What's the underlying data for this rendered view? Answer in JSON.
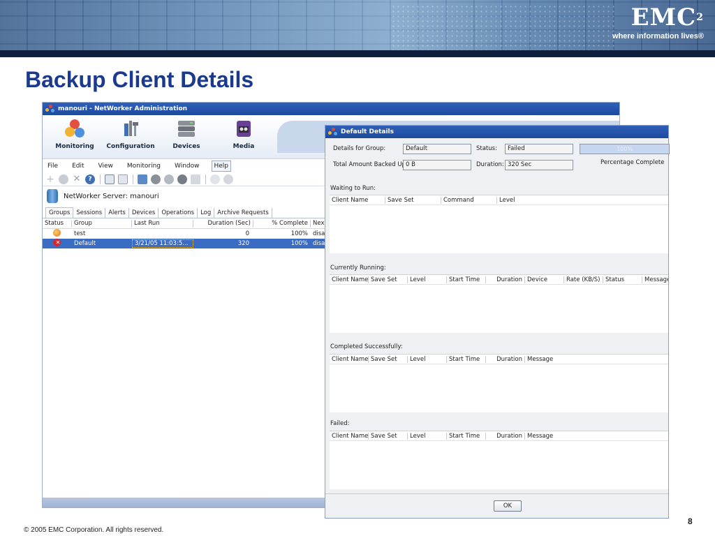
{
  "slide": {
    "title": "Backup Client Details",
    "logo": {
      "brand": "EMC",
      "superscript": "2",
      "tagline": "where information lives®"
    },
    "footer": "© 2005 EMC Corporation. All rights reserved.",
    "page_number": "8"
  },
  "admin": {
    "title": "manouri - NetWorker Administration",
    "nav": [
      "Monitoring",
      "Configuration",
      "Devices",
      "Media"
    ],
    "menu": [
      "File",
      "Edit",
      "View",
      "Monitoring",
      "Window",
      "Help"
    ],
    "server_label": "NetWorker Server: manouri",
    "tabs": [
      "Groups",
      "Sessions",
      "Alerts",
      "Devices",
      "Operations",
      "Log",
      "Archive Requests"
    ],
    "columns": [
      "Status",
      "Group",
      "Last Run",
      "Duration (Sec)",
      "% Complete",
      "Nex"
    ],
    "rows": [
      {
        "group": "test",
        "last_run": "",
        "duration": "0",
        "complete": "100%",
        "next": "disa",
        "status_icon": "success-icon"
      },
      {
        "group": "Default",
        "last_run": "3/21/05 11:03:5...",
        "duration": "320",
        "complete": "100%",
        "next": "disa",
        "status_icon": "failed-icon"
      }
    ]
  },
  "dialog": {
    "title": "Default Details",
    "details_for_group_label": "Details for Group:",
    "details_for_group_value": "Default",
    "status_label": "Status:",
    "status_value": "Failed",
    "progress_value": "100%",
    "total_backed_label": "Total Amount Backed Up:",
    "total_backed_value": "0 B",
    "duration_label": "Duration:",
    "duration_value": "320 Sec",
    "percentage_label": "Percentage Complete",
    "waiting": {
      "label": "Waiting to Run:",
      "columns": [
        "Client Name",
        "Save Set",
        "Command",
        "Level"
      ]
    },
    "running": {
      "label": "Currently Running:",
      "columns": [
        "Client Name",
        "Save Set",
        "Level",
        "Start Time",
        "Duration",
        "Device",
        "Rate (KB/S)",
        "Status",
        "Message"
      ]
    },
    "completed": {
      "label": "Completed Successfully:",
      "columns": [
        "Client Name",
        "Save Set",
        "Level",
        "Start Time",
        "Duration",
        "Message"
      ]
    },
    "failed": {
      "label": "Failed:",
      "columns": [
        "Client Name",
        "Save Set",
        "Level",
        "Start Time",
        "Duration",
        "Message"
      ]
    },
    "ok_label": "OK"
  },
  "colors": {
    "title_blue": "#1b3a8e",
    "selection": "#3b6cc4",
    "titlebar": "#1d4a9e"
  }
}
